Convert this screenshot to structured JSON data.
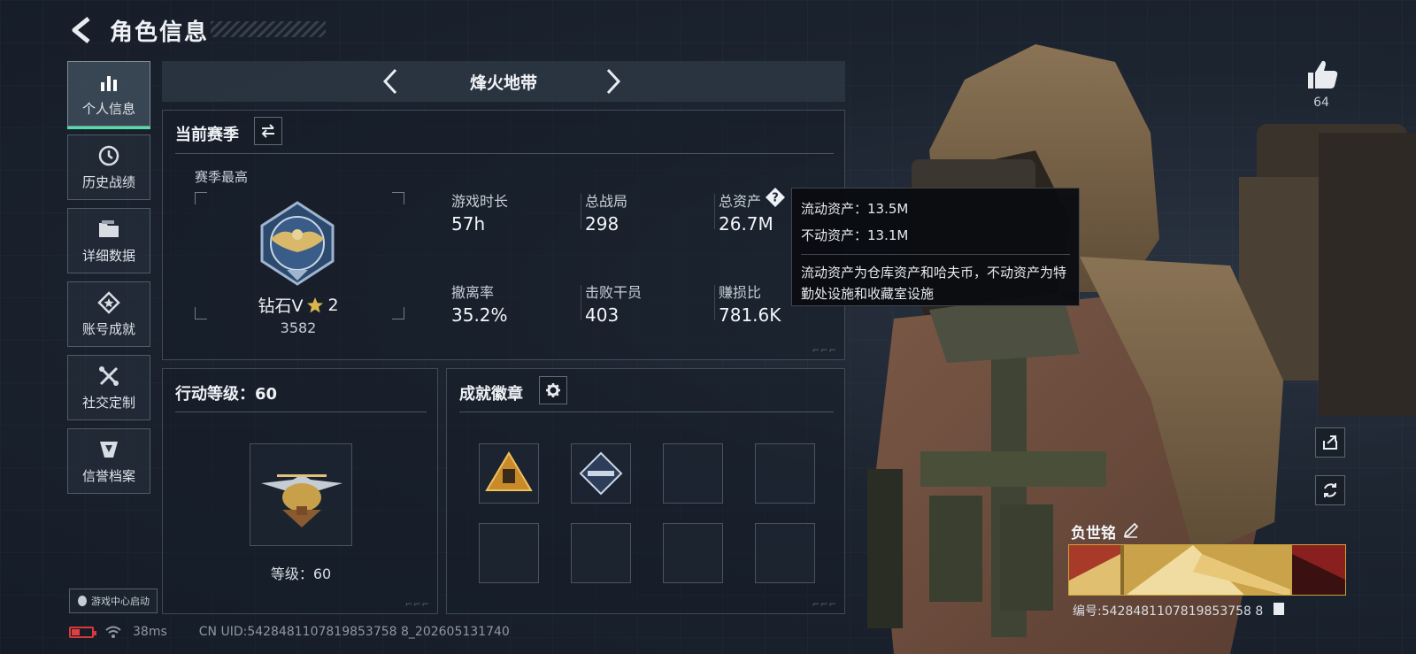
{
  "header": {
    "title": "角色信息",
    "back_icon": "chevron-left-icon"
  },
  "sidebar": {
    "items": [
      {
        "label": "个人信息",
        "icon": "bar-chart-icon",
        "active": true
      },
      {
        "label": "历史战绩",
        "icon": "clock-icon",
        "active": false
      },
      {
        "label": "详细数据",
        "icon": "folder-icon",
        "active": false
      },
      {
        "label": "账号成就",
        "icon": "star-badge-icon",
        "active": false
      },
      {
        "label": "社交定制",
        "icon": "tools-icon",
        "active": false
      },
      {
        "label": "信誉档案",
        "icon": "shield-badge-icon",
        "active": false
      }
    ],
    "launch_label": "游戏中心启动"
  },
  "status": {
    "ping": "38ms",
    "uid": "CN UID:5428481107819853758 8_202605131740"
  },
  "mode": {
    "title": "烽火地带"
  },
  "season": {
    "title": "当前赛季",
    "best_label": "赛季最高",
    "rank_name": "钻石Ⅴ",
    "rank_stars": "2",
    "rank_score": "3582",
    "stats": [
      {
        "label": "游戏时长",
        "value": "57h"
      },
      {
        "label": "总战局",
        "value": "298"
      },
      {
        "label": "总资产",
        "value": "26.7M"
      },
      {
        "label": "撤离率",
        "value": "35.2%"
      },
      {
        "label": "击败干员",
        "value": "403"
      },
      {
        "label": "赚损比",
        "value": "781.6K"
      }
    ]
  },
  "tooltip": {
    "liquid": "流动资产：13.5M",
    "fixed": "不动资产：13.1M",
    "desc": "流动资产为仓库资产和哈夫币，不动资产为特勤处设施和收藏室设施"
  },
  "action": {
    "title": "行动等级：60",
    "level_text": "等级：60"
  },
  "achievements": {
    "title": "成就徽章"
  },
  "profile": {
    "likes": "64",
    "name": "负世铭",
    "number": "编号:5428481107819853758 8"
  },
  "colors": {
    "accent": "#4fe0a6",
    "battery": "#e04040",
    "gold": "#c9a43a"
  }
}
